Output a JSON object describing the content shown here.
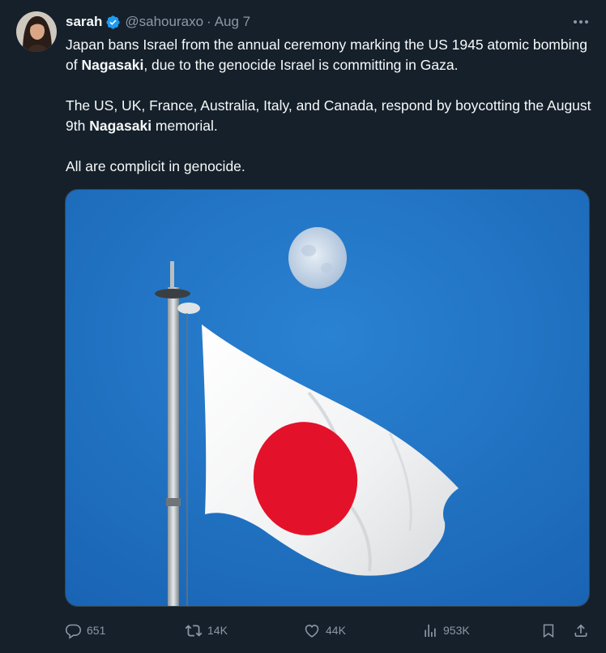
{
  "author": {
    "display_name": "sarah",
    "handle": "@sahouraxo",
    "separator": "·",
    "date": "Aug 7"
  },
  "tweet": {
    "p1": {
      "before": "Japan bans Israel from the annual ceremony marking the US 1945 atomic bombing of ",
      "bold": "Nagasaki",
      "after": ", due to the genocide Israel is committing in Gaza."
    },
    "p2": {
      "before": "The US, UK, France, Australia, Italy, and Canada, respond by boycotting the August 9th ",
      "bold": "Nagasaki",
      "after": " memorial."
    },
    "p3": "All are complicit in genocide."
  },
  "actions": {
    "replies": "651",
    "reposts": "14K",
    "likes": "44K",
    "views": "953K"
  },
  "colors": {
    "background": "#15202b",
    "text": "#f7f9f9",
    "muted": "#8b98a5",
    "verified": "#1d9bf0",
    "sky": "#1f73c4",
    "flag_disc": "#e3122a"
  },
  "icons": [
    "verified-badge-icon",
    "more-icon",
    "reply-icon",
    "repost-icon",
    "like-icon",
    "views-icon",
    "bookmark-icon",
    "share-icon"
  ]
}
